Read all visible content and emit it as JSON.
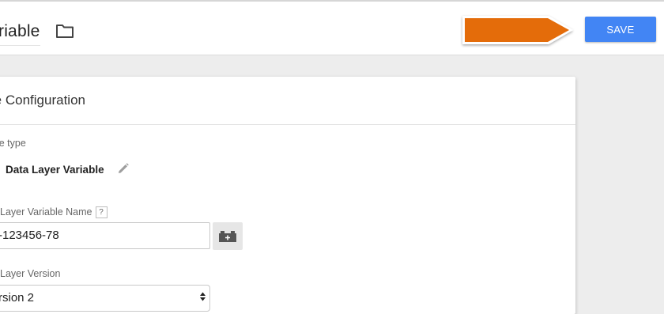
{
  "header": {
    "title": "riable",
    "save_label": "SAVE",
    "folder_icon": "folder-icon",
    "annotation_arrow_color": "#e46c0a"
  },
  "config": {
    "title": "able Configuration",
    "type_label": "ble type",
    "type_value": "Data Layer Variable",
    "name_label": "Layer Variable Name",
    "help_label": "?",
    "name_value": "-123456-78",
    "version_label": "Layer Version",
    "version_value": "rsion 2"
  },
  "colors": {
    "accent": "#4285f4",
    "arrow": "#e46c0a"
  }
}
